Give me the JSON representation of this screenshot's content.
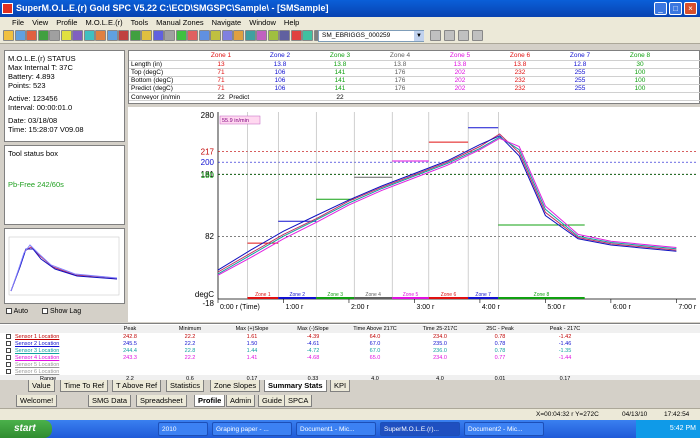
{
  "window": {
    "title": "SuperM.O.L.E.(r) Gold SPC V5.22  C:\\ECD\\SMGSPC\\Sample\\ - [SMSample]",
    "controls": [
      "_",
      "□",
      "×"
    ]
  },
  "menu": [
    "File",
    "View",
    "Profile",
    "M.O.L.E.(r)",
    "Tools",
    "Manual Zones",
    "Navigate",
    "Window",
    "Help"
  ],
  "toolbar": {
    "file_select": "SM_EBRIGGS_000259"
  },
  "mole_status": {
    "lines": [
      "M.O.L.E.(r) STATUS",
      "Max Internal T: 37C",
      "Battery: 4.893",
      "Points: 523",
      "Active: 123456",
      "Interval: 00:00:01.0",
      "Date: 03/18/08",
      "Time: 15:28:07 V09.08"
    ]
  },
  "tool_status": {
    "title": "Tool status box",
    "text": "Pb-Free 242/60s"
  },
  "mini": {
    "auto": "Auto",
    "show_lag": "Show Lag"
  },
  "zones": {
    "headers": [
      "Zone 1",
      "Zone 2",
      "Zone 3",
      "Zone 4",
      "Zone 5",
      "Zone 6",
      "Zone 7",
      "Zone 8"
    ],
    "header_colors": [
      "#e01010",
      "#1010d0",
      "#10a010",
      "#606060",
      "#e010e0",
      "#e01010",
      "#1010d0",
      "#10a010"
    ],
    "rows": [
      {
        "label": "Length (in)",
        "values": [
          "13",
          "13.8",
          "13.8",
          "13.8",
          "13.8",
          "13.8",
          "12.8",
          "30"
        ]
      },
      {
        "label": "Top (degC)",
        "values": [
          "71",
          "106",
          "141",
          "176",
          "202",
          "232",
          "255",
          "100"
        ]
      },
      {
        "label": "Bottom (degC)",
        "values": [
          "71",
          "106",
          "141",
          "176",
          "202",
          "232",
          "255",
          "100"
        ]
      },
      {
        "label": "Predict (degC)",
        "values": [
          "71",
          "106",
          "141",
          "176",
          "202",
          "232",
          "255",
          "100"
        ]
      }
    ],
    "conveyor_label": "Conveyor (in/min",
    "conveyor_value": "22",
    "predict_label": "Predict",
    "predict_value": "22"
  },
  "chart": {
    "y_max_label": "280",
    "y_labels": [
      "217",
      "200",
      "181",
      "180",
      "82"
    ],
    "y_label_colors": [
      "#c00000",
      "#1010d0",
      "#000000",
      "#10a010",
      "#000000"
    ],
    "y_unit": "degC",
    "y_min": "-18",
    "speed_box": "55.9 in/min",
    "zone_labels": [
      "Zone 1",
      "Zone 2",
      "Zone 3",
      "Zone 4",
      "Zone 5",
      "Zone 6",
      "Zone 7",
      "Zone 8"
    ],
    "x_ticks": [
      "0:00 r (Time)",
      "1:00 r",
      "2:00 r",
      "3:00 r",
      "4:00 r",
      "5:00 r",
      "6:00 r",
      "7:00 r"
    ]
  },
  "chart_data": {
    "type": "line",
    "x_unit": "min",
    "y_unit": "degC",
    "ylim": [
      -18,
      280
    ],
    "series": [
      {
        "name": "Sensor 1 Location",
        "color": "#c03060",
        "x": [
          0,
          0.5,
          1,
          1.5,
          2,
          2.5,
          3,
          3.5,
          4,
          4.3,
          4.6,
          5,
          5.5,
          6,
          7
        ],
        "y": [
          25,
          55,
          85,
          110,
          138,
          160,
          180,
          200,
          225,
          245,
          215,
          120,
          80,
          70,
          60
        ]
      },
      {
        "name": "Sensor 2 Location",
        "color": "#1010c0",
        "x": [
          0,
          0.5,
          1,
          1.5,
          2,
          2.5,
          3,
          3.5,
          4,
          4.3,
          4.6,
          5,
          5.5,
          6,
          7
        ],
        "y": [
          28,
          60,
          90,
          115,
          140,
          162,
          182,
          202,
          228,
          242,
          210,
          115,
          78,
          68,
          58
        ]
      },
      {
        "name": "Sensor 3 Location",
        "color": "#10a0a0",
        "x": [
          0,
          0.5,
          1,
          1.5,
          2,
          2.5,
          3,
          3.5,
          4,
          4.3,
          4.6,
          5,
          5.5,
          6,
          7
        ],
        "y": [
          22,
          52,
          82,
          108,
          135,
          158,
          178,
          198,
          222,
          240,
          220,
          125,
          82,
          72,
          62
        ]
      },
      {
        "name": "Sensor 4 Location",
        "color": "#e020e0",
        "x": [
          0,
          0.5,
          1,
          1.5,
          2,
          2.5,
          3,
          3.5,
          4,
          4.3,
          4.6,
          5,
          5.5,
          6,
          7
        ],
        "y": [
          20,
          48,
          78,
          104,
          132,
          155,
          175,
          195,
          220,
          238,
          225,
          130,
          85,
          74,
          64
        ]
      }
    ]
  },
  "stats": {
    "headers": [
      "",
      "Peak",
      "Minimum",
      "Max (+)Slope",
      "Max (-)Slope",
      "Time Above 217C",
      "Time 25-217C",
      "25C - Peak",
      "Peak - 217C"
    ],
    "rows": [
      {
        "label": "Sensor 1 Location",
        "color": "#c00000",
        "values": [
          "242.8",
          "22.2",
          "1.61",
          "-4.39",
          "64.0",
          "234.0",
          "0.78",
          "-1.42"
        ]
      },
      {
        "label": "Sensor 2 Location",
        "color": "#1010d0",
        "values": [
          "245.5",
          "22.2",
          "1.50",
          "-4.61",
          "67.0",
          "235.0",
          "0.78",
          "-1.46"
        ]
      },
      {
        "label": "Sensor 3 Location",
        "color": "#10a0a0",
        "values": [
          "244.4",
          "22.8",
          "1.44",
          "-4.72",
          "67.0",
          "236.0",
          "0.78",
          "-1.35"
        ]
      },
      {
        "label": "Sensor 4 Location",
        "color": "#e010e0",
        "values": [
          "243.3",
          "22.2",
          "1.41",
          "-4.68",
          "65.0",
          "234.0",
          "0.77",
          "-1.44"
        ]
      },
      {
        "label": "Sensor 5 Location",
        "color": "#999999",
        "values": [
          "",
          "",
          "",
          "",
          "",
          "",
          "",
          ""
        ]
      },
      {
        "label": "Sensor 6 Location",
        "color": "#999999",
        "values": [
          "",
          "",
          "",
          "",
          "",
          "",
          "",
          ""
        ]
      }
    ],
    "range": {
      "label": "Range",
      "values": [
        "2.2",
        "0.6",
        "0.17",
        "0.33",
        "4.0",
        "4.0",
        "0.01",
        "0.17"
      ]
    }
  },
  "tabs_top": [
    "Value",
    "Time To Ref",
    "T Above Ref",
    "Statistics",
    "Zone Slopes",
    "Summary Stats",
    "KPI"
  ],
  "tabs_bottom": [
    "Welcome!",
    "SMG Data",
    "Spreadsheet",
    "Profile",
    "Admin",
    "Guide",
    "SPCA"
  ],
  "statusbar": {
    "coords": "X=00:04:32 r Y=272C",
    "date": "04/13/10",
    "time": "17:42:54"
  },
  "taskbar": {
    "start": "start",
    "items": [
      "2010",
      "Graping paper - ...",
      "Document1 - Mic...",
      "SuperM.O.L.E.(r)...",
      "Document2 - Mic..."
    ],
    "clock": "5:42 PM"
  }
}
